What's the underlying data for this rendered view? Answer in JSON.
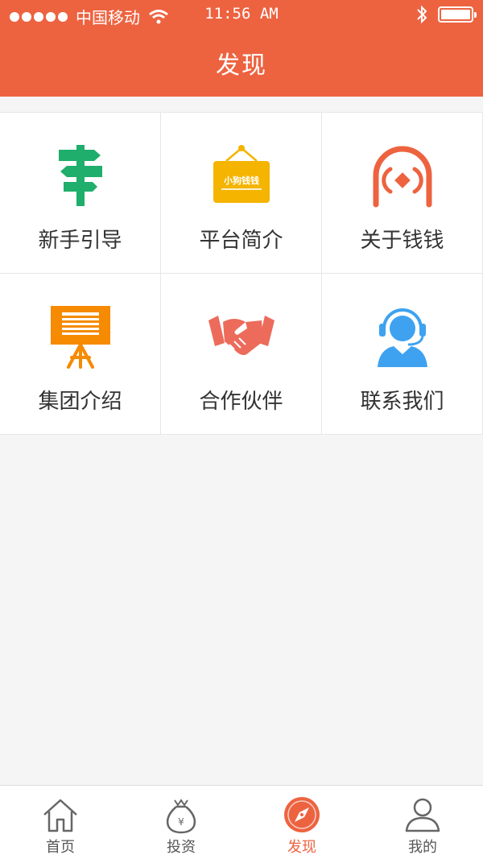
{
  "status_bar": {
    "carrier": "中国移动",
    "time": "11:56 AM"
  },
  "header": {
    "title": "发现"
  },
  "grid": {
    "items": [
      {
        "label": "新手引导",
        "icon": "signpost-icon",
        "color": "#1fae6b"
      },
      {
        "label": "平台简介",
        "icon": "brand-sign-icon",
        "color": "#f4b400",
        "sign_text": "小狗钱钱"
      },
      {
        "label": "关于钱钱",
        "icon": "coin-arch-icon",
        "color": "#ed6340"
      },
      {
        "label": "集团介绍",
        "icon": "presentation-board-icon",
        "color": "#f68a00"
      },
      {
        "label": "合作伙伴",
        "icon": "handshake-icon",
        "color": "#ed6b5b"
      },
      {
        "label": "联系我们",
        "icon": "customer-service-icon",
        "color": "#3ea2f0"
      }
    ]
  },
  "tabbar": {
    "items": [
      {
        "label": "首页",
        "icon": "home-icon"
      },
      {
        "label": "投资",
        "icon": "money-bag-icon",
        "bag_symbol": "¥"
      },
      {
        "label": "发现",
        "icon": "compass-icon",
        "active": true
      },
      {
        "label": "我的",
        "icon": "user-icon"
      }
    ]
  },
  "colors": {
    "accent": "#ed6340",
    "background": "#f5f5f5"
  }
}
